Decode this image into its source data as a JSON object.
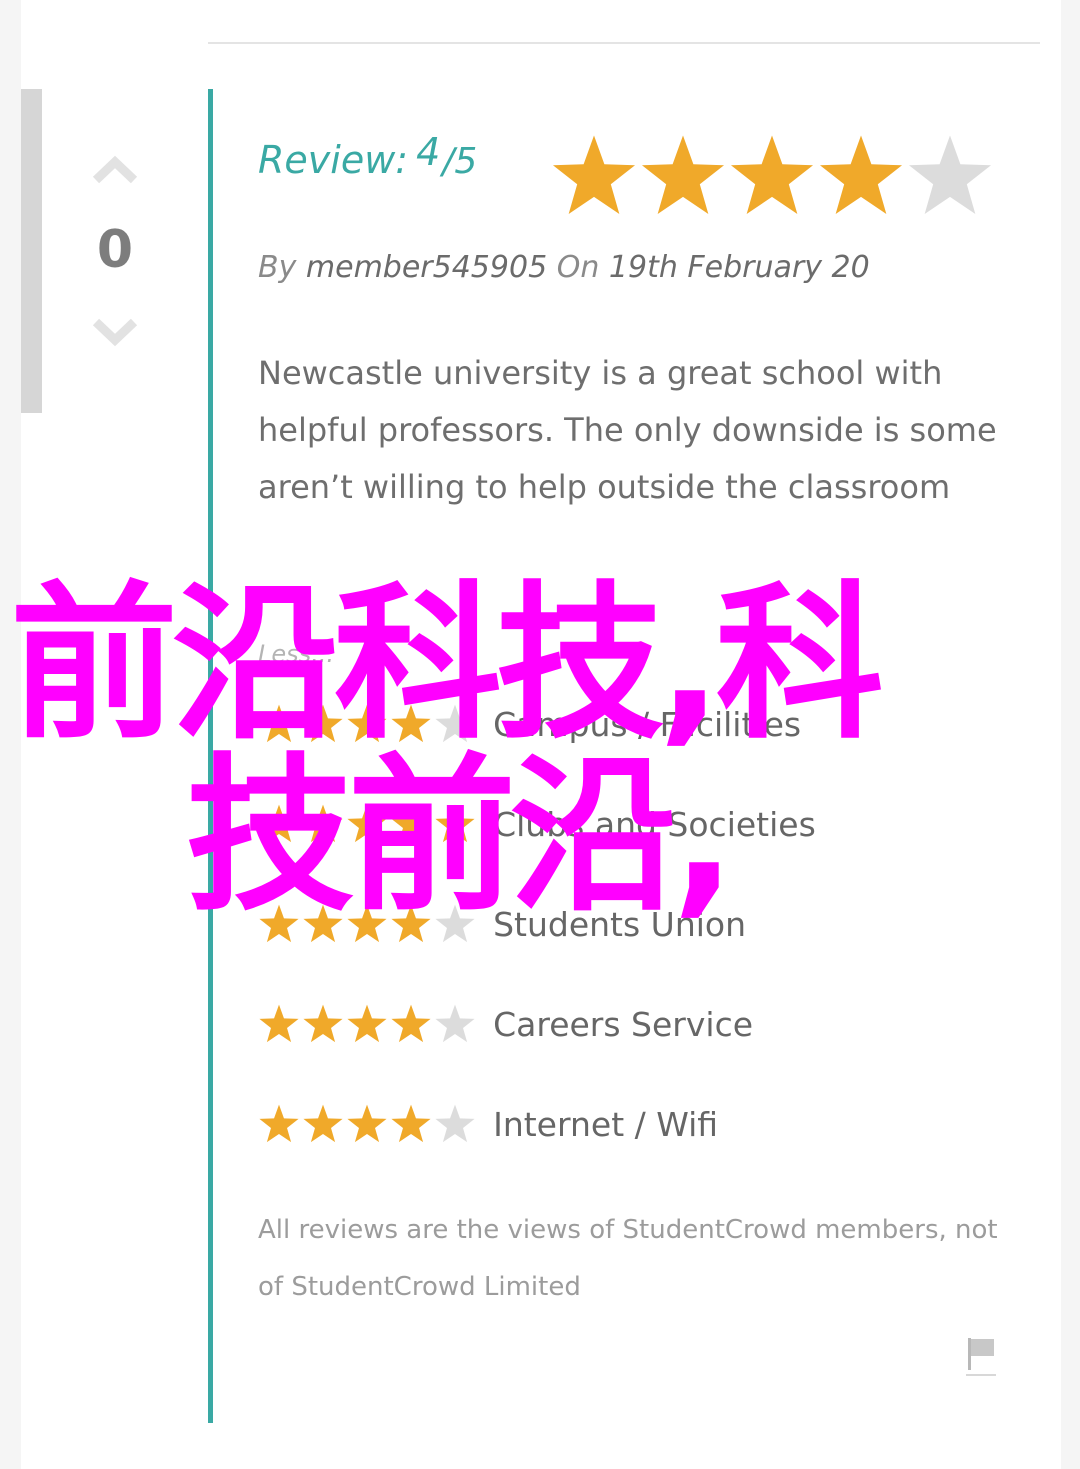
{
  "vote": {
    "count": "0",
    "up_icon": "chevron-up-icon",
    "down_icon": "chevron-down-icon"
  },
  "review": {
    "label": "Review:",
    "score": "4",
    "out_of": "/5",
    "rating": 4,
    "max_rating": 5,
    "by_label": "By",
    "author": "member545905",
    "on_label": "On",
    "date": "19th February 20",
    "text": "Newcastle university is a great school with helpful professors. The only downside is some aren’t willing to help outside the classroom",
    "less_link": "Less..."
  },
  "categories": [
    {
      "label": "Campus / Facilities",
      "rating": 4
    },
    {
      "label": "Clubs and Societies",
      "rating": 5
    },
    {
      "label": "Students Union",
      "rating": 4
    },
    {
      "label": "Careers Service",
      "rating": 4
    },
    {
      "label": "Internet / Wifi",
      "rating": 4
    }
  ],
  "disclaimer": "All reviews are the views of StudentCrowd members, not of StudentCrowd Limited",
  "overlay": {
    "line1": "前沿科技,科",
    "line2": "技前沿,"
  },
  "colors": {
    "accent": "#3aa9a4",
    "star_on": "#f0a92a",
    "star_off": "#dcdcdc",
    "overlay": "#ff00ff"
  },
  "icons": {
    "flag": "flag-icon",
    "star": "star-icon"
  }
}
